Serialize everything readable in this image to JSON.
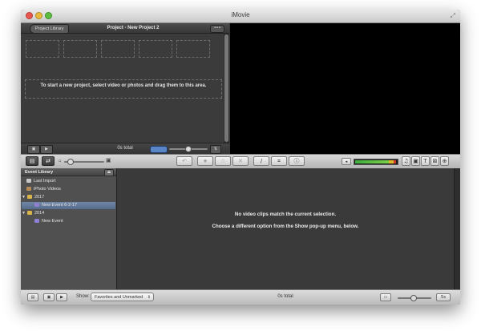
{
  "window": {
    "title": "iMovie"
  },
  "project": {
    "library_button": "Project Library",
    "title": "Project - New Project 2",
    "more_label": "•••",
    "drop_hint": "To start a new project, select video or photos and drag them to this area.",
    "total": "0s total"
  },
  "event_library": {
    "header": "Event Library",
    "items": [
      {
        "label": "Last Import",
        "icon": "library-icon"
      },
      {
        "label": "iPhoto Videos",
        "icon": "photo-icon"
      },
      {
        "label": "2017",
        "icon": "folder-icon",
        "expanded": true
      },
      {
        "label": "New Event 6-2-17",
        "icon": "event-icon",
        "selected": true
      },
      {
        "label": "2014",
        "icon": "folder-icon",
        "expanded": true
      },
      {
        "label": "New Event",
        "icon": "event-icon"
      }
    ]
  },
  "browser": {
    "message_primary": "No video clips match the current selection.",
    "message_secondary": "Choose a different option from the Show pop-up menu, below."
  },
  "bottombar": {
    "show_label": "Show:",
    "show_value": "Favorites and Unmarked",
    "total": "0s total",
    "zoom_value": "5s"
  },
  "toolbar": {
    "icons": [
      "camera-import-icon",
      "swap-icon",
      "add-to-project-icon",
      "favorite-star-icon",
      "unmark-star-icon",
      "reject-x-icon",
      "keyword-icon",
      "crop-icon",
      "info-icon",
      "audio-meter",
      "music-icon",
      "photo-browser-icon",
      "titles-icon",
      "transitions-icon",
      "maps-icon"
    ]
  },
  "colors": {
    "viewer_background": "#000000",
    "selection": "#6f86a8",
    "meter_green": "#3fae3f",
    "meter_yellow": "#e0b829",
    "meter_red": "#d23b2b"
  }
}
